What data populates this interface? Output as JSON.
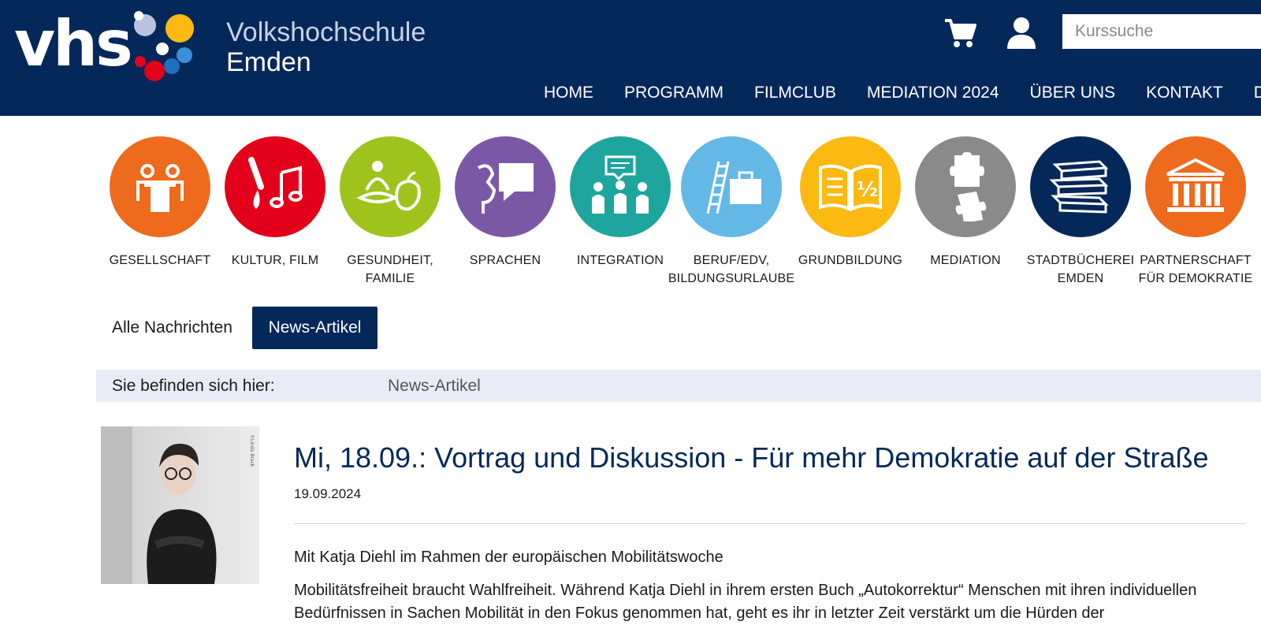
{
  "header": {
    "logo_text": "vhs",
    "title": "Volkshochschule",
    "subtitle": "Emden",
    "search_placeholder": "Kurssuche",
    "cart_icon": "cart-icon",
    "user_icon": "user-icon",
    "bg_color": "#05285a"
  },
  "nav": {
    "items": [
      {
        "label": "HOME"
      },
      {
        "label": "PROGRAMM"
      },
      {
        "label": "FILMCLUB"
      },
      {
        "label": "MEDIATION 2024"
      },
      {
        "label": "ÜBER UNS"
      },
      {
        "label": "KONTAKT"
      },
      {
        "label": "DATE"
      }
    ]
  },
  "categories": [
    {
      "label": "GESELLSCHAFT",
      "color": "#ee6a1c",
      "icon": "people-icon"
    },
    {
      "label": "KULTUR, FILM",
      "color": "#e2001a",
      "icon": "brush-music-icon"
    },
    {
      "label": "GESUNDHEIT, FAMILIE",
      "color": "#9ec31d",
      "icon": "meditation-apple-icon"
    },
    {
      "label": "SPRACHEN",
      "color": "#7b58a6",
      "icon": "speech-icon"
    },
    {
      "label": "INTEGRATION",
      "color": "#1da59e",
      "icon": "group-speech-icon"
    },
    {
      "label": "BERUF/EDV, BILDUNGSURLAUBE",
      "color": "#64b8e6",
      "icon": "ladder-briefcase-icon"
    },
    {
      "label": "GRUNDBILDUNG",
      "color": "#fbb911",
      "icon": "book-half-icon"
    },
    {
      "label": "MEDIATION",
      "color": "#8a8a8a",
      "icon": "puzzle-icon"
    },
    {
      "label": "STADTBÜCHEREI EMDEN",
      "color": "#05285a",
      "icon": "books-icon"
    },
    {
      "label": "PARTNERSCHAFT FÜR DEMOKRATIE",
      "color": "#ee6a1c",
      "icon": "building-icon"
    }
  ],
  "tabs": [
    {
      "label": "Alle Nachrichten"
    },
    {
      "label": "News-Artikel"
    }
  ],
  "breadcrumb": {
    "label": "Sie befinden sich hier:",
    "current": "News-Artikel"
  },
  "article": {
    "photo_credit": "©Linda Brack",
    "title": "Mi, 18.09.: Vortrag und Diskussion - Für mehr Demokratie auf der Straße",
    "date": "19.09.2024",
    "lead": "Mit Katja Diehl im Rahmen der europäischen Mobilitätswoche",
    "body": "Mobilitätsfreiheit braucht Wahlfreiheit. Während Katja Diehl in ihrem ersten Buch „Autokorrektur“ Menschen mit ihren indivi­duellen Bedürfnissen in Sachen Mobilität in den Fokus genommen hat, geht es ihr in letzter Zeit verstärkt um die Hürden der"
  }
}
